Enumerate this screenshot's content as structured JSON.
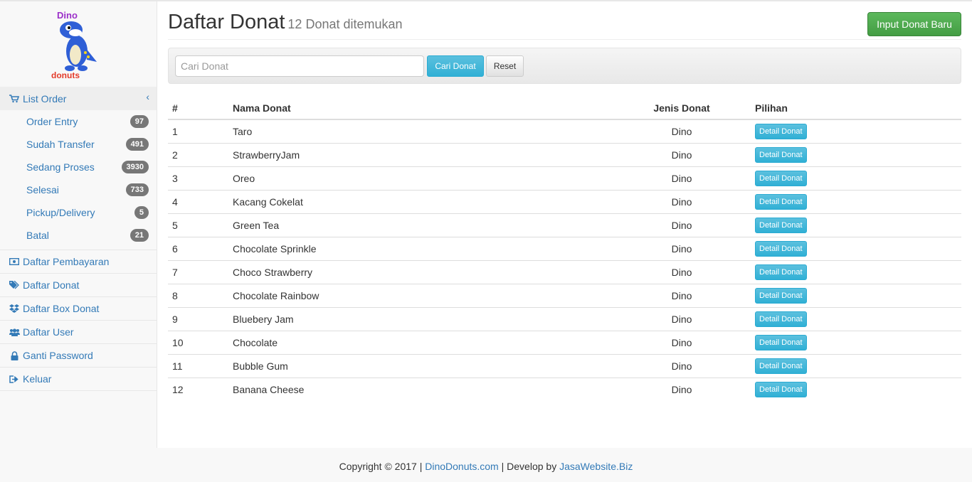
{
  "logo": {
    "text_top": "Dino",
    "text_bottom": "donuts"
  },
  "sidebar": {
    "list_order": {
      "label": "List Order",
      "caret": "‹"
    },
    "sub_items": [
      {
        "label": "Order Entry",
        "count": "97"
      },
      {
        "label": "Sudah Transfer",
        "count": "491"
      },
      {
        "label": "Sedang Proses",
        "count": "3930"
      },
      {
        "label": "Selesai",
        "count": "733"
      },
      {
        "label": "Pickup/Delivery",
        "count": "5"
      },
      {
        "label": "Batal",
        "count": "21"
      }
    ],
    "items": [
      {
        "label": "Daftar Pembayaran",
        "icon": "money-icon"
      },
      {
        "label": "Daftar Donat",
        "icon": "tags-icon"
      },
      {
        "label": "Daftar Box Donat",
        "icon": "dropbox-icon"
      },
      {
        "label": "Daftar User",
        "icon": "users-icon"
      },
      {
        "label": "Ganti Password",
        "icon": "lock-icon"
      },
      {
        "label": "Keluar",
        "icon": "sign-out-icon"
      }
    ]
  },
  "header": {
    "title": "Daftar Donat",
    "subtitle": "12 Donat ditemukan",
    "new_button": "Input Donat Baru"
  },
  "search": {
    "placeholder": "Cari Donat",
    "value": "",
    "search_button": "Cari Donat",
    "reset_button": "Reset"
  },
  "table": {
    "columns": [
      "#",
      "Nama Donat",
      "Jenis Donat",
      "Pilihan"
    ],
    "detail_label": "Detail Donat",
    "rows": [
      {
        "no": "1",
        "name": "Taro",
        "type": "Dino"
      },
      {
        "no": "2",
        "name": "StrawberryJam",
        "type": "Dino"
      },
      {
        "no": "3",
        "name": "Oreo",
        "type": "Dino"
      },
      {
        "no": "4",
        "name": "Kacang Cokelat",
        "type": "Dino"
      },
      {
        "no": "5",
        "name": "Green Tea",
        "type": "Dino"
      },
      {
        "no": "6",
        "name": "Chocolate Sprinkle",
        "type": "Dino"
      },
      {
        "no": "7",
        "name": "Choco Strawberry",
        "type": "Dino"
      },
      {
        "no": "8",
        "name": "Chocolate Rainbow",
        "type": "Dino"
      },
      {
        "no": "9",
        "name": "Bluebery Jam",
        "type": "Dino"
      },
      {
        "no": "10",
        "name": "Chocolate",
        "type": "Dino"
      },
      {
        "no": "11",
        "name": "Bubble Gum",
        "type": "Dino"
      },
      {
        "no": "12",
        "name": "Banana Cheese",
        "type": "Dino"
      }
    ]
  },
  "footer": {
    "copyright": "Copyright © 2017 |",
    "site_link": "DinoDonuts.com",
    "develop_text": "| Develop by",
    "dev_link": "JasaWebsite.Biz"
  },
  "colors": {
    "link": "#337ab7",
    "info": "#5bc0de",
    "success": "#5cb85c",
    "badge": "#777777"
  }
}
